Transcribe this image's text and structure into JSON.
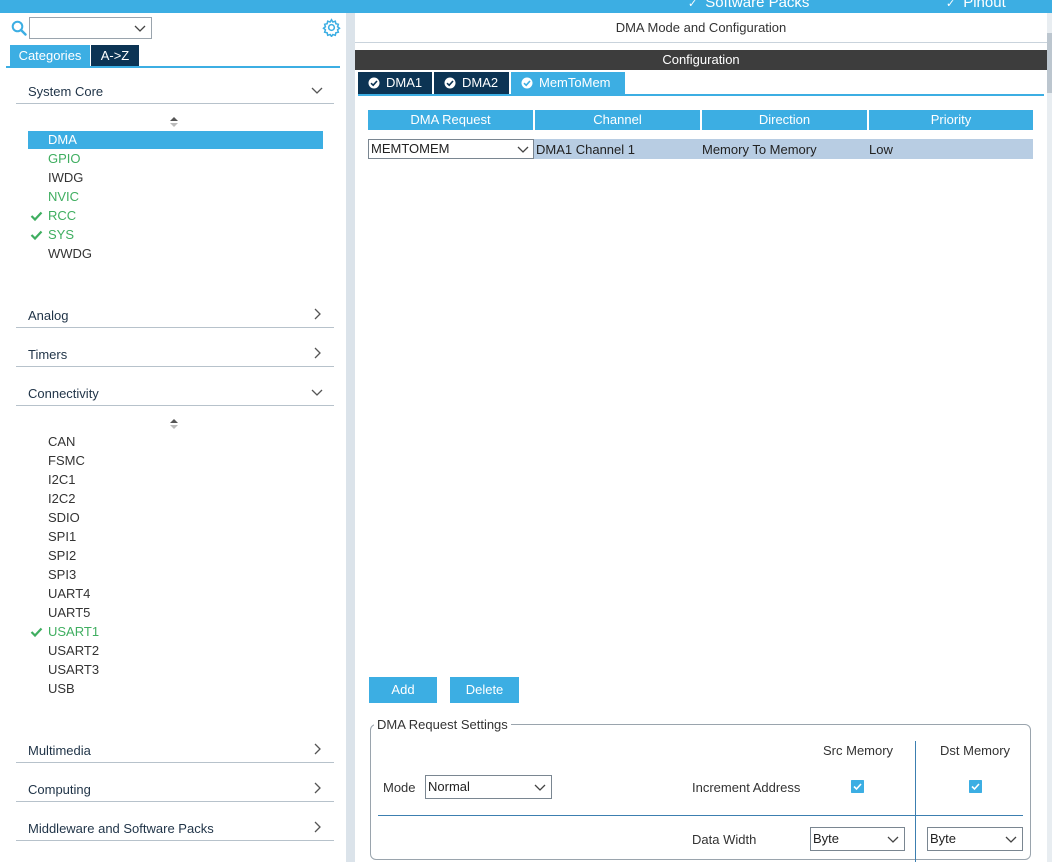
{
  "topbar": {
    "items": [
      {
        "label": "Software Packs"
      },
      {
        "label": "Pinout"
      }
    ]
  },
  "left": {
    "search": {
      "value": ""
    },
    "category_tabs": [
      "Categories",
      "A->Z"
    ],
    "system_core": {
      "label": "System Core",
      "items": [
        {
          "label": "DMA",
          "state": "selected"
        },
        {
          "label": "GPIO",
          "state": "green"
        },
        {
          "label": "IWDG",
          "state": "normal"
        },
        {
          "label": "NVIC",
          "state": "green"
        },
        {
          "label": "RCC",
          "state": "checked"
        },
        {
          "label": "SYS",
          "state": "checked"
        },
        {
          "label": "WWDG",
          "state": "normal"
        }
      ]
    },
    "analog": {
      "label": "Analog"
    },
    "timers": {
      "label": "Timers"
    },
    "connectivity": {
      "label": "Connectivity",
      "items": [
        {
          "label": "CAN",
          "state": "normal"
        },
        {
          "label": "FSMC",
          "state": "normal"
        },
        {
          "label": "I2C1",
          "state": "normal"
        },
        {
          "label": "I2C2",
          "state": "normal"
        },
        {
          "label": "SDIO",
          "state": "normal"
        },
        {
          "label": "SPI1",
          "state": "normal"
        },
        {
          "label": "SPI2",
          "state": "normal"
        },
        {
          "label": "SPI3",
          "state": "normal"
        },
        {
          "label": "UART4",
          "state": "normal"
        },
        {
          "label": "UART5",
          "state": "normal"
        },
        {
          "label": "USART1",
          "state": "checked"
        },
        {
          "label": "USART2",
          "state": "normal"
        },
        {
          "label": "USART3",
          "state": "normal"
        },
        {
          "label": "USB",
          "state": "normal"
        }
      ]
    },
    "multimedia": {
      "label": "Multimedia"
    },
    "computing": {
      "label": "Computing"
    },
    "middleware": {
      "label": "Middleware and Software Packs"
    }
  },
  "right": {
    "title": "DMA Mode and Configuration",
    "config_bar": "Configuration",
    "tabs": [
      "DMA1",
      "DMA2",
      "MemToMem"
    ],
    "table": {
      "headers": [
        "DMA Request",
        "Channel",
        "Direction",
        "Priority"
      ],
      "rows": [
        {
          "request": "MEMTOMEM",
          "channel": "DMA1 Channel 1",
          "direction": "Memory To Memory",
          "priority": "Low"
        }
      ]
    },
    "buttons": {
      "add": "Add",
      "delete": "Delete"
    },
    "settings": {
      "title": "DMA Request Settings",
      "src_memory": "Src Memory",
      "dst_memory": "Dst Memory",
      "mode_label": "Mode",
      "mode_value": "Normal",
      "increment_label": "Increment Address",
      "src_increment": true,
      "dst_increment": true,
      "data_width_label": "Data Width",
      "src_width": "Byte",
      "dst_width": "Byte"
    }
  },
  "colors": {
    "accent": "#3caee3",
    "dark_tab": "#0c3454",
    "green": "#3fae60",
    "table_row": "#b8cde3"
  }
}
